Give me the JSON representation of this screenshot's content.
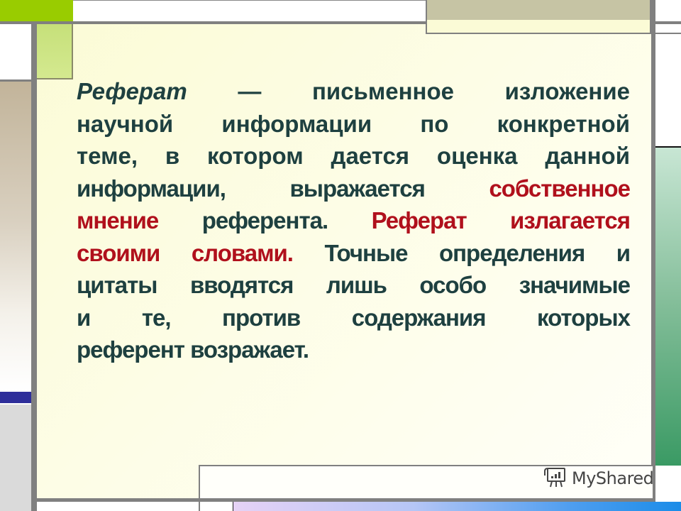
{
  "slide": {
    "lines": [
      [
        {
          "text": "Реферат",
          "style": "italic"
        },
        {
          "text": " — письменное изложение",
          "style": "normal"
        }
      ],
      [
        {
          "text": "научной информации по конкретной",
          "style": "normal"
        }
      ],
      [
        {
          "text": "теме, в котором дается оценка данной",
          "style": "normal"
        }
      ],
      [
        {
          "text": "информации, выражается ",
          "style": "normal"
        },
        {
          "text": "собственное",
          "style": "red"
        }
      ],
      [
        {
          "text": "мнение",
          "style": "red"
        },
        {
          "text": " референта. ",
          "style": "normal"
        },
        {
          "text": "Реферат излагается",
          "style": "red"
        }
      ],
      [
        {
          "text": "своими словами.",
          "style": "red"
        },
        {
          "text": " Точные определения и",
          "style": "normal"
        }
      ],
      [
        {
          "text": "цитаты вводятся лишь особо значимые",
          "style": "normal"
        }
      ],
      [
        {
          "text": "и те, против содержания которых",
          "style": "normal"
        }
      ],
      [
        {
          "text": "референт возражает.",
          "style": "normal"
        }
      ]
    ],
    "text_color": "#1e4040",
    "highlight_color": "#b0101c"
  },
  "watermark": {
    "icon": "presentation-board-icon",
    "label": "MyShared"
  },
  "colors": {
    "accent_green": "#99cc00",
    "panel_cream": "#fbfbd6",
    "frame_grey": "#808080",
    "right_strip_green": "#3a9a64",
    "left_strip_tan": "#c2b49a",
    "left_bar_blue": "#2e2e9a"
  }
}
